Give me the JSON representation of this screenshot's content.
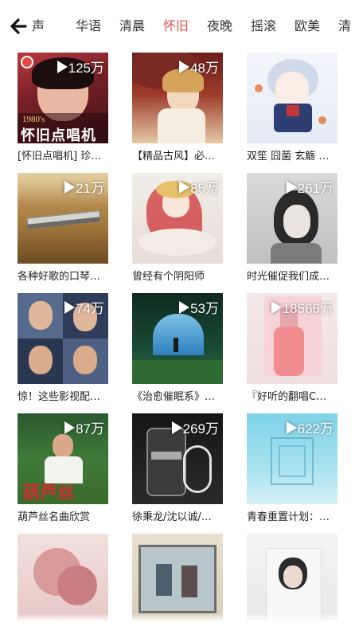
{
  "nav": {
    "back_icon": "arrow-left-icon",
    "tabs": [
      {
        "label": "声",
        "active": false
      },
      {
        "label": "华语",
        "active": false
      },
      {
        "label": "清晨",
        "active": false
      },
      {
        "label": "怀旧",
        "active": true
      },
      {
        "label": "夜晚",
        "active": false
      },
      {
        "label": "摇滚",
        "active": false
      },
      {
        "label": "欧美",
        "active": false
      },
      {
        "label": "清",
        "active": false
      }
    ]
  },
  "colors": {
    "active_tab": "#e1524b",
    "text": "#222222"
  },
  "playlists": [
    {
      "count": "125万",
      "title": "[怀旧点唱机] 珍…",
      "cover_text": "怀旧点唱机",
      "cover_year": "1980's"
    },
    {
      "count": "48万",
      "title": "【精品古风】必…"
    },
    {
      "count": "",
      "title": "双笙 囧菌 玄觞 …"
    },
    {
      "count": "21万",
      "title": "各种好歌的口琴…"
    },
    {
      "count": "85万",
      "title": "曾经有个阴阳师"
    },
    {
      "count": "261万",
      "title": "时光催促我们成…"
    },
    {
      "count": "74万",
      "title": "惊！这些影视配…"
    },
    {
      "count": "53万",
      "title": "《治愈催眠系》…"
    },
    {
      "count": "18566万",
      "title": "『好听的翻唱C…"
    },
    {
      "count": "87万",
      "title": "葫芦丝名曲欣赏",
      "cover_text": "葫芦丝"
    },
    {
      "count": "269万",
      "title": "徐秉龙/沈以诚/…"
    },
    {
      "count": "622万",
      "title": "青春重置计划：…"
    },
    {
      "count": "",
      "title": ""
    },
    {
      "count": "",
      "title": ""
    },
    {
      "count": "",
      "title": ""
    }
  ]
}
